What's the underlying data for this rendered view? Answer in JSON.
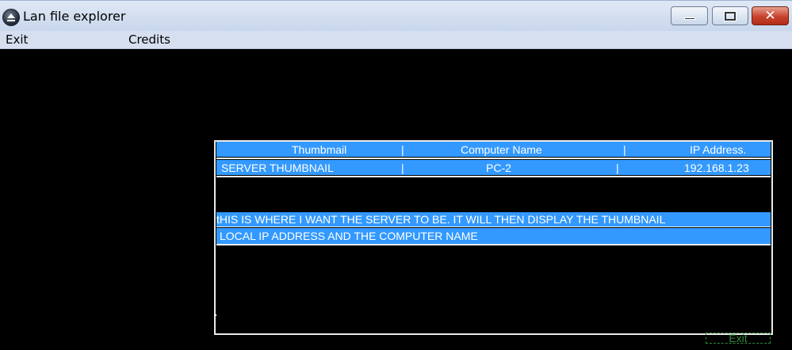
{
  "window": {
    "title": "Lan file explorer",
    "icon": "app-globe-icon"
  },
  "menu": {
    "exit": "Exit",
    "credits": "Credits"
  },
  "table": {
    "headers": {
      "thumbnail": "Thumbmail",
      "computer_name": "Computer Name",
      "ip": "IP Address."
    },
    "row": {
      "thumbnail": "SERVER THUMBNAIL",
      "computer_name": "PC-2",
      "ip": "192.168.1.23"
    },
    "separator": "|",
    "note_line1": "tHIS IS WHERE I WANT THE SERVER TO BE. IT WILL THEN DISPLAY THE THUMBNAIL",
    "note_line2": " LOCAL IP ADDRESS AND THE COMPUTER NAME"
  },
  "ghost_button": "Exit",
  "colors": {
    "row_blue": "#3399ff",
    "background": "#000000",
    "ghost_green": "#2f8a3a"
  }
}
